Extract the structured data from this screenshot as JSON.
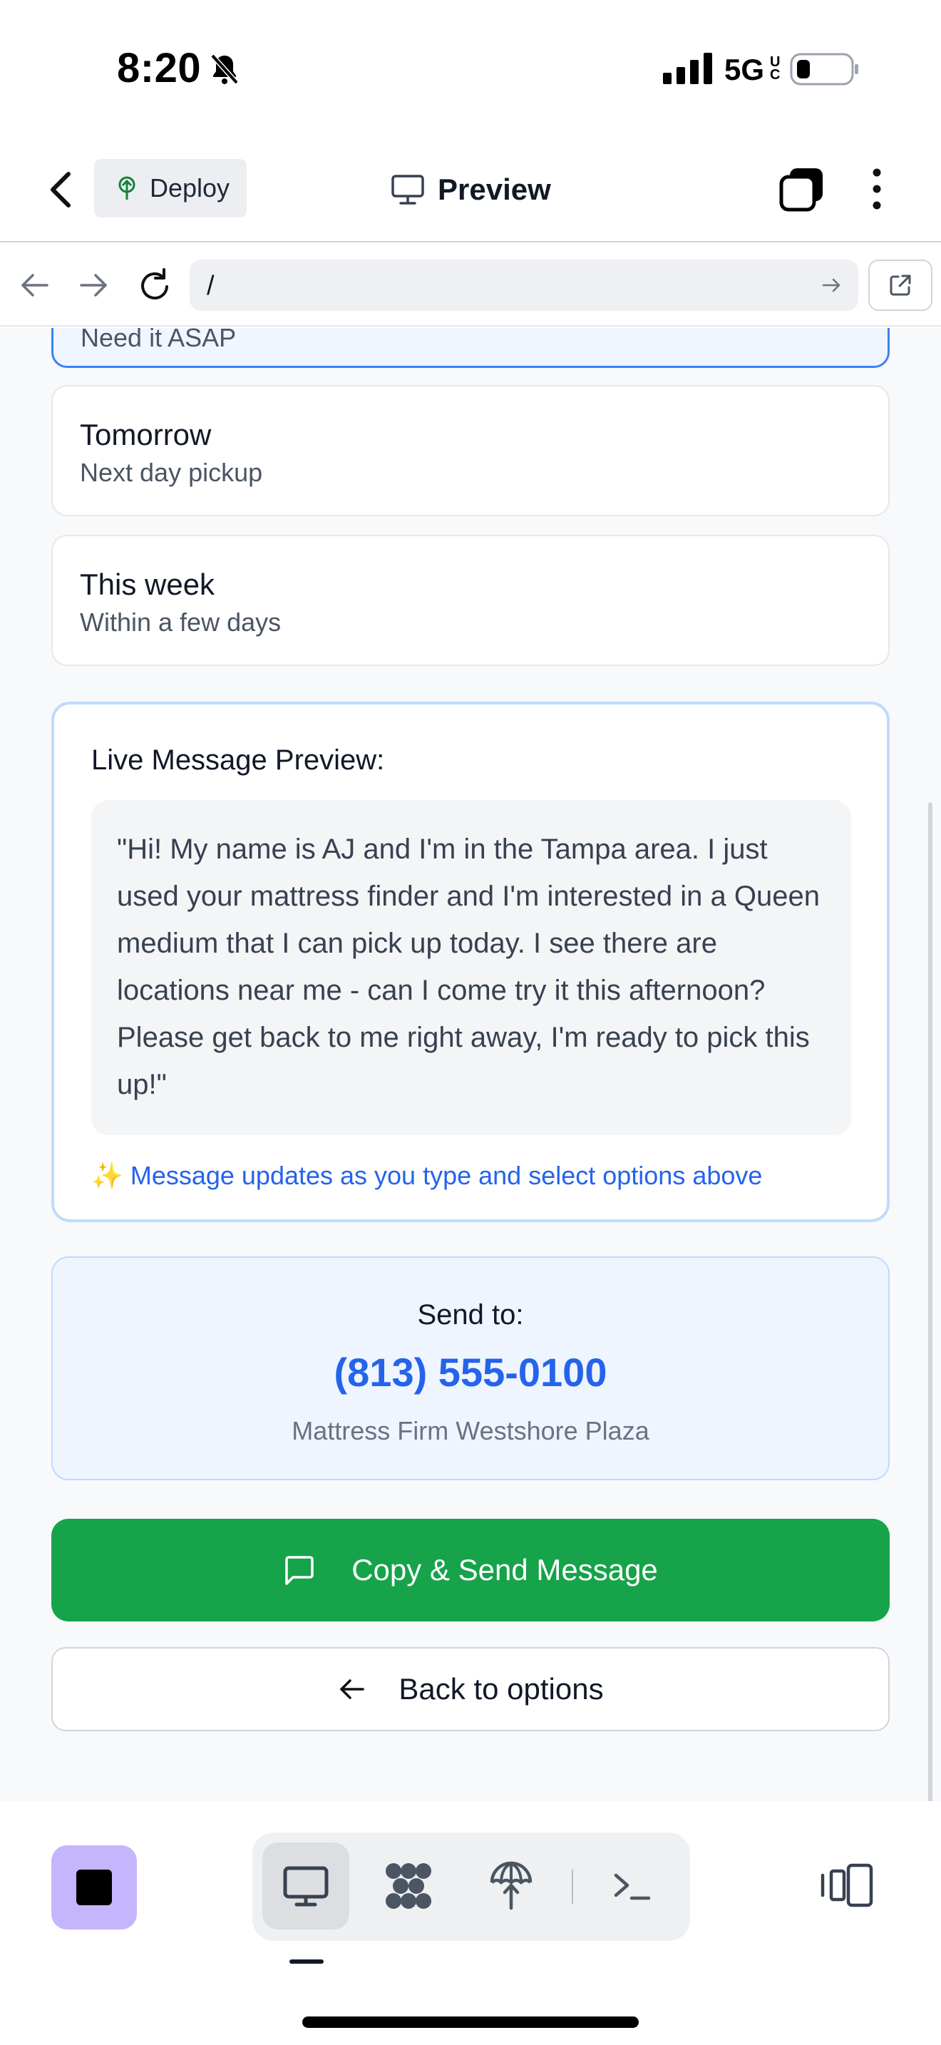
{
  "status_bar": {
    "time": "8:20",
    "network": "5G",
    "network_suffix": "UC",
    "icons": [
      "bell-slash-icon",
      "cellular-signal-icon",
      "battery-low-icon"
    ]
  },
  "header": {
    "deploy_label": "Deploy",
    "title": "Preview"
  },
  "browser": {
    "url": "/"
  },
  "options": {
    "selected_sub_partial": "Need it ASAP",
    "items": [
      {
        "title": "Tomorrow",
        "subtitle": "Next day pickup"
      },
      {
        "title": "This week",
        "subtitle": "Within a few days"
      }
    ]
  },
  "preview": {
    "label": "Live Message Preview:",
    "message": "\"Hi! My name is AJ and I'm in the Tampa area. I just used your mattress finder and I'm interested in a Queen medium that I can pick up today. I see there are locations near me - can I come try it this afternoon? Please get back to me right away, I'm ready to pick this up!\"",
    "note": "✨ Message updates as you type and select options above"
  },
  "send_to": {
    "label": "Send to:",
    "phone": "(813) 555-0100",
    "store": "Mattress Firm Westshore Plaza"
  },
  "actions": {
    "send_label": "Copy & Send Message",
    "back_label": "Back to options"
  },
  "colors": {
    "accent_blue": "#2563eb",
    "send_green": "#16a34a",
    "agent_purple": "#c4b5fd"
  }
}
